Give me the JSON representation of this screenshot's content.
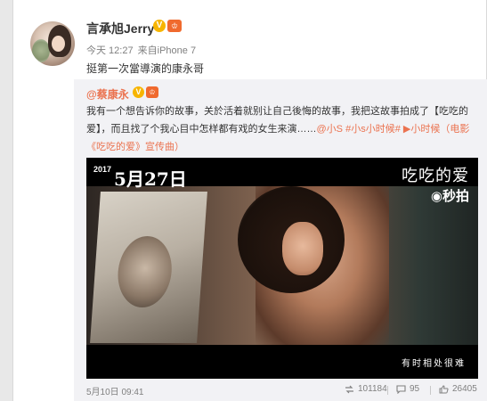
{
  "post": {
    "username": "言承旭Jerry",
    "verified_badge": "V",
    "member_badge": "♔",
    "time": "今天 12:27",
    "source": "来自iPhone 7",
    "text": "挺第一次當導演的康永哥"
  },
  "repost": {
    "author": "@蔡康永",
    "verified_badge": "V",
    "member_badge": "♔",
    "text_line1": "我有一个想告诉你的故事，关於活着就别让自己後悔的故事，我把这故事拍成了【吃吃的",
    "text_line2_prefix": "爱】，而且找了个我心目中怎样都有戏的女生来演……",
    "mention": "@小S",
    "hashtag": "#小s小时候#",
    "video_link": "小时候",
    "movie_link": "（电影《吃吃的爱》宣传曲）",
    "video": {
      "year": "2017",
      "date": "5月27日",
      "title": "吃吃的爱",
      "brand": "秒拍",
      "subtitle": "有时相处很难"
    },
    "footer": {
      "time": "5月10日 09:41",
      "reposts": "101184",
      "comments": "95",
      "likes": "26405"
    }
  },
  "colors": {
    "link": "#eb7350",
    "badge_v": "#f7b500",
    "badge_member": "#f06a2e"
  }
}
